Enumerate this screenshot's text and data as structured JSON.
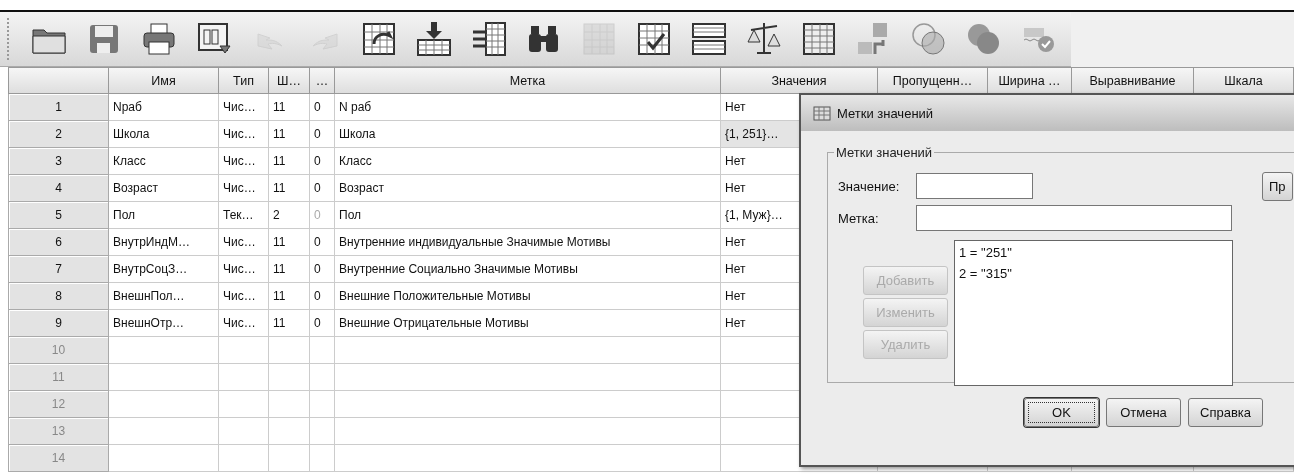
{
  "toolbar": [
    {
      "kind": "open",
      "disabled": false
    },
    {
      "kind": "save",
      "disabled": false
    },
    {
      "kind": "print",
      "disabled": false
    },
    {
      "kind": "dialog_recall",
      "disabled": false
    },
    {
      "kind": "undo",
      "disabled": true
    },
    {
      "kind": "redo",
      "disabled": true
    },
    {
      "kind": "goto_case",
      "disabled": false
    },
    {
      "kind": "insert_case",
      "disabled": false
    },
    {
      "kind": "variables",
      "disabled": false
    },
    {
      "kind": "find",
      "disabled": false
    },
    {
      "kind": "split",
      "disabled": true
    },
    {
      "kind": "select_cases",
      "disabled": false
    },
    {
      "kind": "split_file",
      "disabled": false
    },
    {
      "kind": "weight",
      "disabled": false
    },
    {
      "kind": "grid",
      "disabled": false
    },
    {
      "kind": "value_labels",
      "disabled": false
    },
    {
      "kind": "sets",
      "disabled": false
    },
    {
      "kind": "all_sets",
      "disabled": false
    },
    {
      "kind": "spelling",
      "disabled": false
    }
  ],
  "table": {
    "columns": [
      "Имя",
      "Тип",
      "Ш…",
      "…",
      "Метка",
      "Значения",
      "Пропущенн…",
      "Ширина …",
      "Выравнивание",
      "Шкала"
    ],
    "rows": [
      {
        "number": "1",
        "dimmed": false,
        "cells": [
          "Nраб",
          "Чис…",
          "11",
          "0",
          "N раб",
          "Нет"
        ],
        "decimals_dimmed": false,
        "values_selected": false
      },
      {
        "number": "2",
        "dimmed": false,
        "cells": [
          "Школа",
          "Чис…",
          "11",
          "0",
          "Школа",
          "{1, 251}…"
        ],
        "decimals_dimmed": false,
        "values_selected": true
      },
      {
        "number": "3",
        "dimmed": false,
        "cells": [
          "Класс",
          "Чис…",
          "11",
          "0",
          "Класс",
          "Нет"
        ],
        "decimals_dimmed": false,
        "values_selected": false
      },
      {
        "number": "4",
        "dimmed": false,
        "cells": [
          "Возраст",
          "Чис…",
          "11",
          "0",
          "Возраст",
          "Нет"
        ],
        "decimals_dimmed": false,
        "values_selected": false
      },
      {
        "number": "5",
        "dimmed": false,
        "cells": [
          "Пол",
          "Тек…",
          "2",
          "0",
          "Пол",
          "{1, Муж}…"
        ],
        "decimals_dimmed": true,
        "values_selected": false
      },
      {
        "number": "6",
        "dimmed": false,
        "cells": [
          "ВнутрИндМ…",
          "Чис…",
          "11",
          "0",
          "Внутренние индивидуальные Значимые Мотивы",
          "Нет"
        ],
        "decimals_dimmed": false,
        "values_selected": false
      },
      {
        "number": "7",
        "dimmed": false,
        "cells": [
          "ВнутрСоцЗ…",
          "Чис…",
          "11",
          "0",
          "Внутренние Социально Значимые Мотивы",
          "Нет"
        ],
        "decimals_dimmed": false,
        "values_selected": false
      },
      {
        "number": "8",
        "dimmed": false,
        "cells": [
          "ВнешнПол…",
          "Чис…",
          "11",
          "0",
          "Внешние Положительные Мотивы",
          "Нет"
        ],
        "decimals_dimmed": false,
        "values_selected": false
      },
      {
        "number": "9",
        "dimmed": false,
        "cells": [
          "ВнешнОтр…",
          "Чис…",
          "11",
          "0",
          "Внешние Отрицательные Мотивы",
          "Нет"
        ],
        "decimals_dimmed": false,
        "values_selected": false
      },
      {
        "number": "10",
        "dimmed": true
      },
      {
        "number": "11",
        "dimmed": true
      },
      {
        "number": "12",
        "dimmed": true
      },
      {
        "number": "13",
        "dimmed": true
      },
      {
        "number": "14",
        "dimmed": true
      }
    ]
  },
  "dialog": {
    "title": "Метки значений",
    "group_title": "Метки значений",
    "value_label": "Значение:",
    "label_label": "Метка:",
    "right_button": "Пр",
    "side_buttons": [
      {
        "label": "Добавить",
        "disabled": true
      },
      {
        "label": "Изменить",
        "disabled": true
      },
      {
        "label": "Удалить",
        "disabled": true
      }
    ],
    "list_items": [
      "1 = \"251\"",
      "2 = \"315\""
    ],
    "buttons": [
      {
        "label": "OK",
        "default": true
      },
      {
        "label": "Отмена",
        "default": false
      },
      {
        "label": "Справка",
        "default": false
      }
    ]
  }
}
